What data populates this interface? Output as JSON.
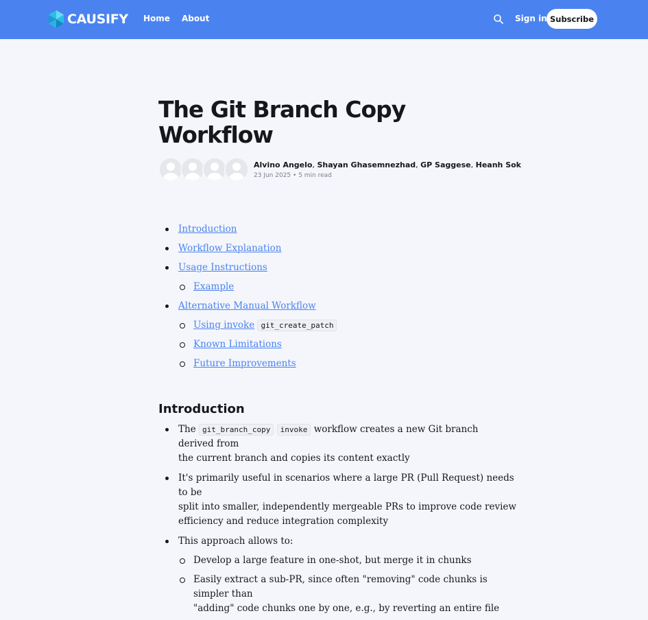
{
  "header": {
    "brand": "CAUSIFY",
    "nav": [
      "Home",
      "About"
    ],
    "search_icon": "search-icon",
    "signin": "Sign in",
    "subscribe": "Subscribe",
    "bg_color": "#4a83f0"
  },
  "article": {
    "title": "The Git Branch Copy Workflow",
    "authors": [
      "Alvino Angelo",
      "Shayan Ghasemnezhad",
      "GP Saggese",
      "Heanh Sok"
    ],
    "date": "23 Jun 2025",
    "read_time": "5 min read"
  },
  "toc": [
    {
      "label": "Introduction"
    },
    {
      "label": "Workflow Explanation"
    },
    {
      "label": "Usage Instructions"
    },
    {
      "label": "Example"
    },
    {
      "label": "Alternative Manual Workflow"
    },
    {
      "label": "Using invoke",
      "code": "git_create_patch"
    },
    {
      "label": "Known Limitations"
    },
    {
      "label": "Future Improvements"
    }
  ],
  "intro": {
    "heading": "Introduction",
    "b1": {
      "pre": "The",
      "code1": "git_branch_copy",
      "code2": "invoke",
      "post": "workflow creates a new Git branch",
      "line2": "derived from",
      "line3": "the current branch and copies its content exactly"
    },
    "b2": {
      "line1": "It's primarily useful in scenarios where a large PR (Pull Request) needs",
      "line2": "to be",
      "line3": "split into smaller, independently mergeable PRs to improve code review",
      "line4": "efficiency and reduce integration complexity"
    },
    "b3": "This approach allows to:",
    "s1": "Develop a large feature in one-shot, but merge it in chunks",
    "s2": {
      "line1": "Easily extract a sub-PR, since often \"removing\" code chunks is",
      "line2": "simpler than",
      "line3": "\"adding\" code chunks one by one, e.g., by reverting an entire file"
    }
  }
}
